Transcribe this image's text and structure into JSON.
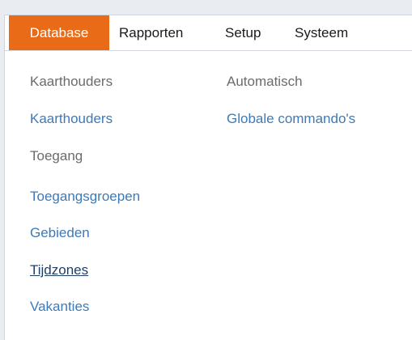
{
  "menubar": {
    "items": [
      {
        "label": "Database"
      },
      {
        "label": "Rapporten"
      },
      {
        "label": "Setup"
      },
      {
        "label": "Systeem"
      }
    ]
  },
  "dropdown": {
    "left_column": [
      {
        "label": "Kaarthouders",
        "kind": "heading"
      },
      {
        "label": "Kaarthouders",
        "kind": "link"
      },
      {
        "label": "Toegang",
        "kind": "heading"
      },
      {
        "label": "Toegangsgroepen",
        "kind": "link"
      },
      {
        "label": "Gebieden",
        "kind": "link"
      },
      {
        "label": "Tijdzones",
        "kind": "link"
      },
      {
        "label": "Vakanties",
        "kind": "link"
      }
    ],
    "right_column": [
      {
        "label": "Automatisch",
        "kind": "heading"
      },
      {
        "label": "Globale commando's",
        "kind": "link"
      }
    ]
  },
  "colors": {
    "active_menu_bg": "#ea6b17",
    "link": "#3c7ab8",
    "heading": "#6b6b6b"
  }
}
